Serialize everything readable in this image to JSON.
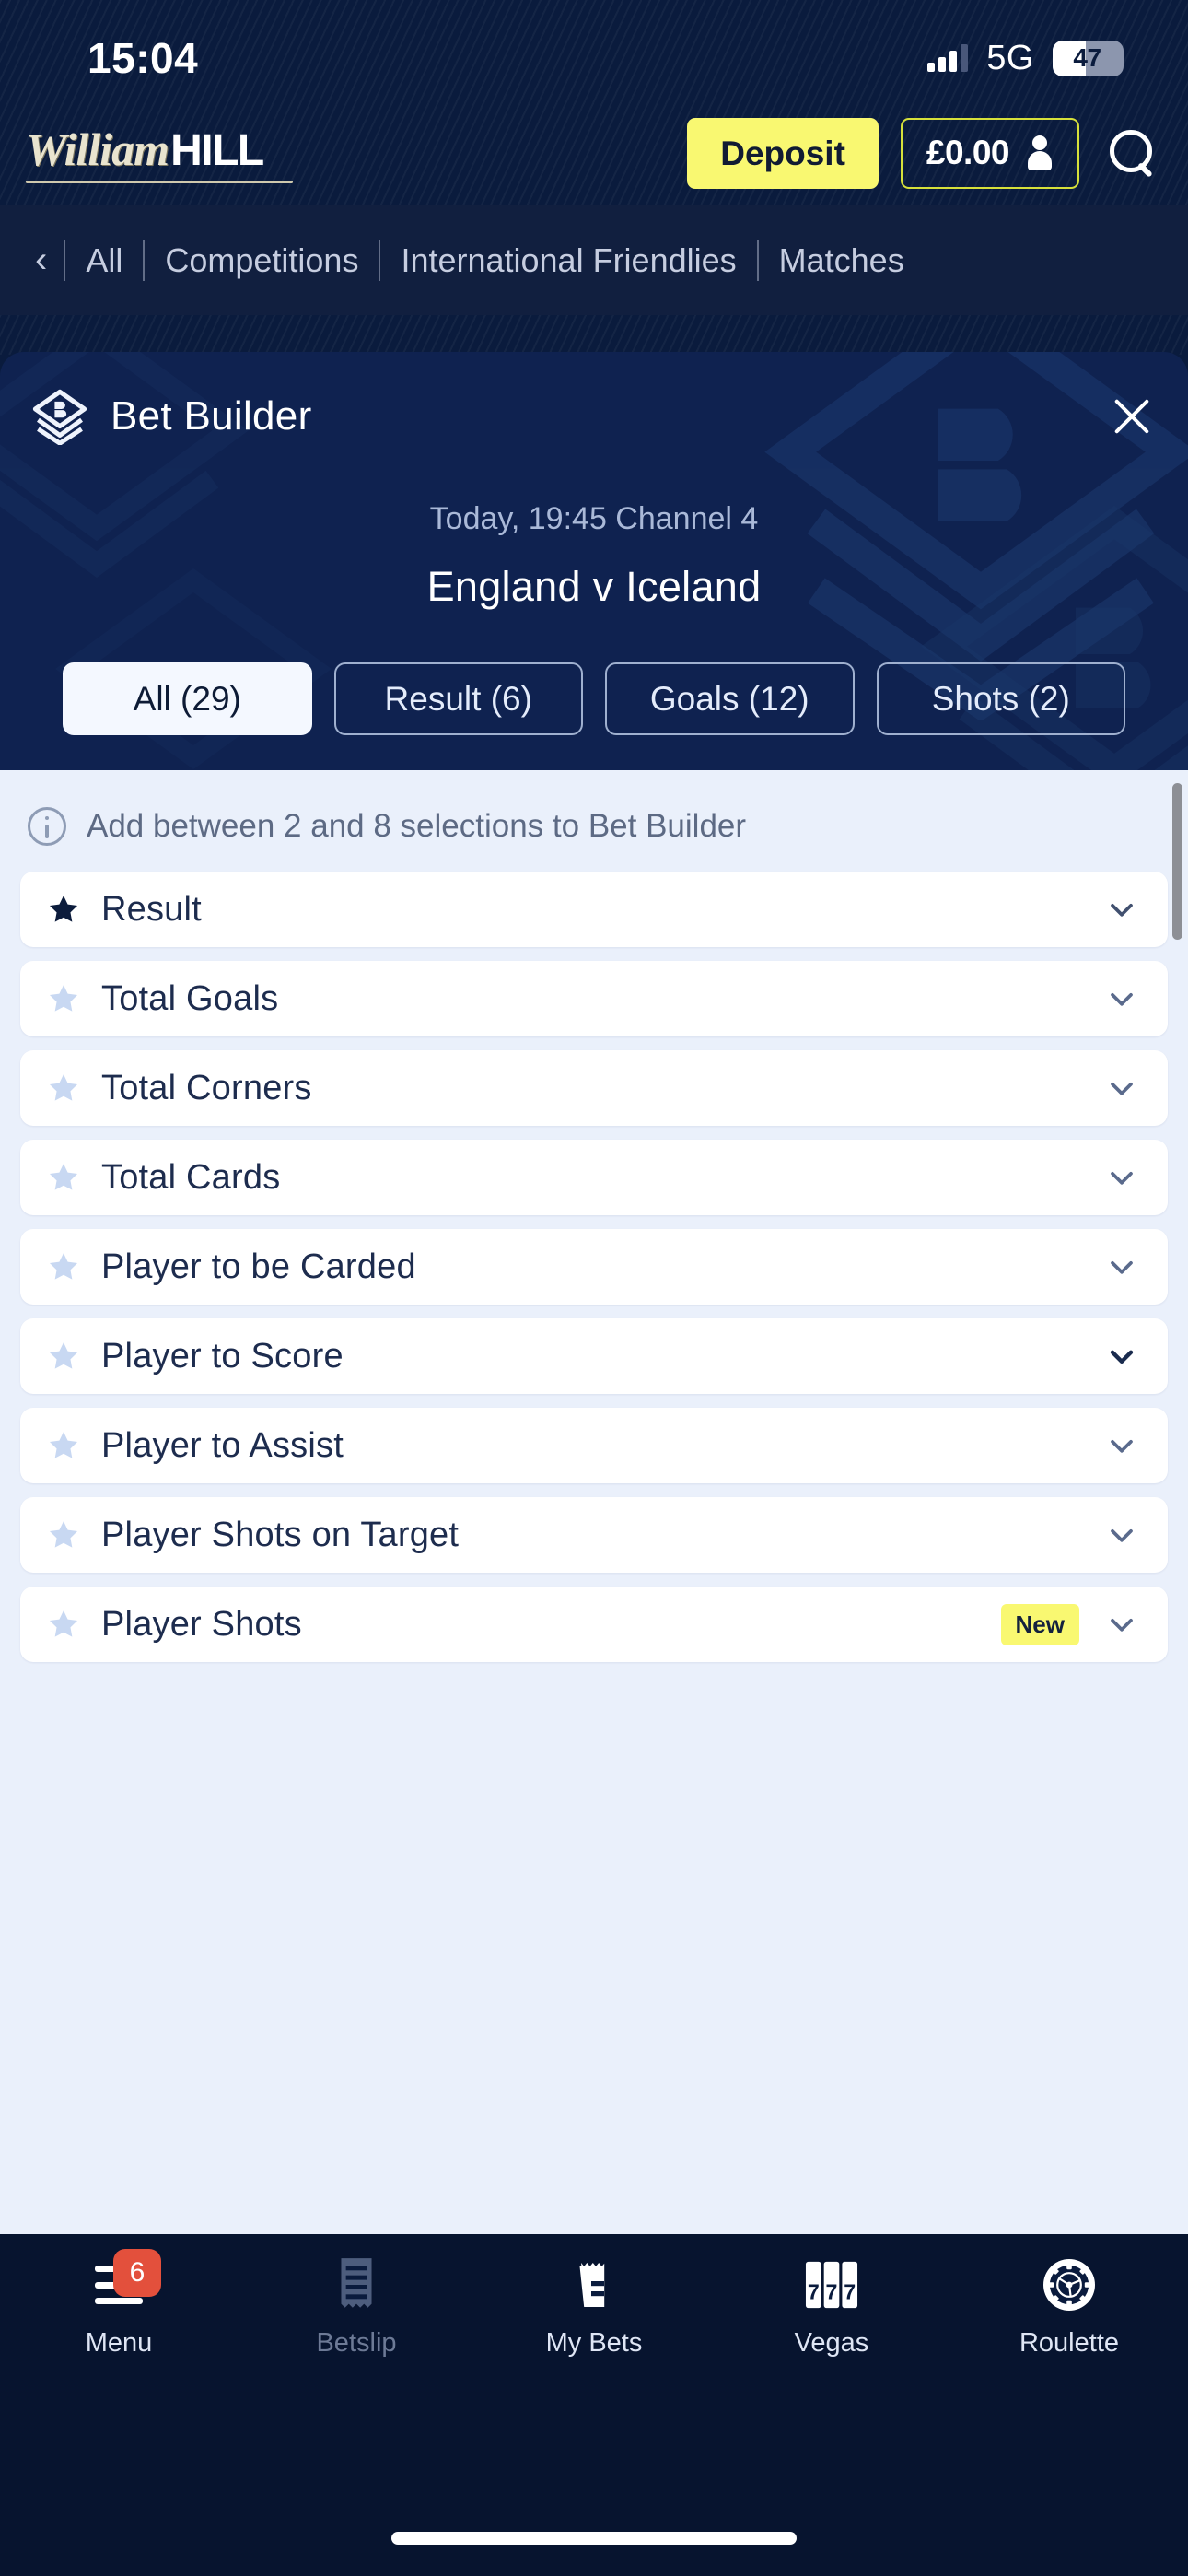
{
  "status_bar": {
    "time": "15:04",
    "network": "5G",
    "battery_level": "47",
    "signal_icon": "signal-bars-icon"
  },
  "header": {
    "brand_script": "William",
    "brand_bold": "HILL",
    "deposit_label": "Deposit",
    "balance": "£0.00",
    "account_icon": "person-icon",
    "search_icon": "search-icon"
  },
  "breadcrumb": {
    "back_icon": "chevron-left-icon",
    "items": [
      "All",
      "Competitions",
      "International Friendlies",
      "Matches"
    ]
  },
  "modal": {
    "title": "Bet Builder",
    "logo_icon": "bet-builder-diamond-icon",
    "close_icon": "close-icon",
    "event_meta": "Today, 19:45 Channel 4",
    "event_name": "England v Iceland",
    "tabs": [
      {
        "label": "All (29)",
        "active": true
      },
      {
        "label": "Result (6)",
        "active": false
      },
      {
        "label": "Goals (12)",
        "active": false
      },
      {
        "label": "Shots (2)",
        "active": false
      }
    ],
    "notice": {
      "icon": "info-circle-icon",
      "text": "Add between 2 and 8 selections to Bet Builder"
    },
    "markets": [
      {
        "label": "Result",
        "starred": true,
        "badge": ""
      },
      {
        "label": "Total Goals",
        "starred": false,
        "badge": ""
      },
      {
        "label": "Total Corners",
        "starred": false,
        "badge": ""
      },
      {
        "label": "Total Cards",
        "starred": false,
        "badge": ""
      },
      {
        "label": "Player to be Carded",
        "starred": false,
        "badge": ""
      },
      {
        "label": "Player to Score",
        "starred": false,
        "badge": ""
      },
      {
        "label": "Player to Assist",
        "starred": false,
        "badge": ""
      },
      {
        "label": "Player Shots on Target",
        "starred": false,
        "badge": ""
      },
      {
        "label": "Player Shots",
        "starred": false,
        "badge": "New"
      }
    ]
  },
  "bottom_nav": [
    {
      "label": "Menu",
      "icon": "hamburger-menu-icon",
      "badge": "6",
      "dim": false
    },
    {
      "label": "Betslip",
      "icon": "betslip-receipt-icon",
      "badge": "",
      "dim": true
    },
    {
      "label": "My Bets",
      "icon": "my-bets-notepad-icon",
      "badge": "",
      "dim": false
    },
    {
      "label": "Vegas",
      "icon": "slot-777-icon",
      "badge": "",
      "dim": false
    },
    {
      "label": "Roulette",
      "icon": "roulette-wheel-icon",
      "badge": "",
      "dim": false
    }
  ],
  "colors": {
    "brand_navy": "#0a1b3d",
    "accent_yellow": "#f9f871",
    "list_bg": "#eaf0fb",
    "badge_red": "#e3503c"
  }
}
